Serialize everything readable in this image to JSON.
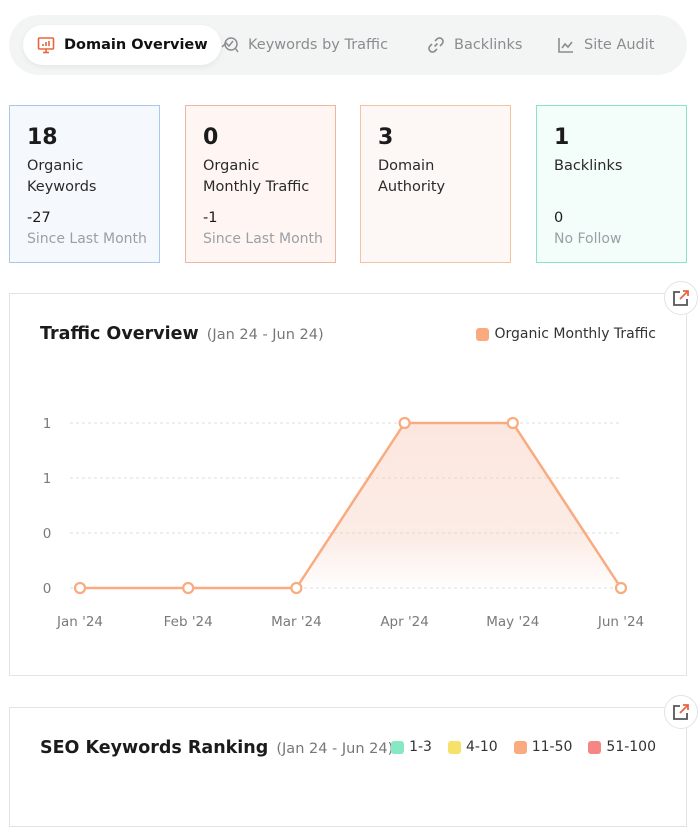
{
  "tabs": [
    {
      "label": "Domain Overview",
      "icon": "presentation-chart-icon",
      "active": true
    },
    {
      "label": "Keywords by Traffic",
      "icon": "search-trend-icon",
      "active": false
    },
    {
      "label": "Backlinks",
      "icon": "link-icon",
      "active": false
    },
    {
      "label": "Site Audit",
      "icon": "line-chart-icon",
      "active": false
    }
  ],
  "stats": [
    {
      "value": "18",
      "label_line1": "Organic",
      "label_line2": "Keywords",
      "change": "-27",
      "change_label": "Since Last Month",
      "border": "#a9c8ee",
      "bg": "#f5f9fe"
    },
    {
      "value": "0",
      "label_line1": "Organic",
      "label_line2": "Monthly Traffic",
      "change": "-1",
      "change_label": "Since Last Month",
      "border": "#f1b49e",
      "bg": "#fff6f4"
    },
    {
      "value": "3",
      "label_line1": "Domain",
      "label_line2": "Authority",
      "change": "",
      "change_label": "",
      "border": "#f2c4a0",
      "bg": "#fdf8f5"
    },
    {
      "value": "1",
      "label_line1": "Backlinks",
      "label_line2": "",
      "change": "0",
      "change_label": "No Follow",
      "border": "#8de3c0",
      "bg": "#f3fdf9"
    }
  ],
  "traffic_panel": {
    "title": "Traffic Overview",
    "range": "(Jan 24 - Jun 24)",
    "legend_label": "Organic Monthly Traffic",
    "legend_color": "#f9ab7f"
  },
  "chart_data": {
    "type": "area",
    "title": "Traffic Overview",
    "subtitle": "(Jan 24 - Jun 24)",
    "categories": [
      "Jan '24",
      "Feb '24",
      "Mar '24",
      "Apr '24",
      "May '24",
      "Jun '24"
    ],
    "series": [
      {
        "name": "Organic Monthly Traffic",
        "values": [
          0,
          0,
          0,
          1,
          1,
          0
        ],
        "color": "#f9ab7f"
      }
    ],
    "y_ticks": [
      "0",
      "0",
      "1",
      "1"
    ],
    "ylim": [
      0,
      1
    ],
    "grid": true,
    "legend": "top-right"
  },
  "ranking_panel": {
    "title": "SEO Keywords Ranking",
    "range": "(Jan 24 - Jun 24)",
    "legend": [
      {
        "label": "1-3",
        "color": "#86e9c4"
      },
      {
        "label": "4-10",
        "color": "#f6e16b"
      },
      {
        "label": "11-50",
        "color": "#f9ab7f"
      },
      {
        "label": "51-100",
        "color": "#f48686"
      }
    ]
  }
}
